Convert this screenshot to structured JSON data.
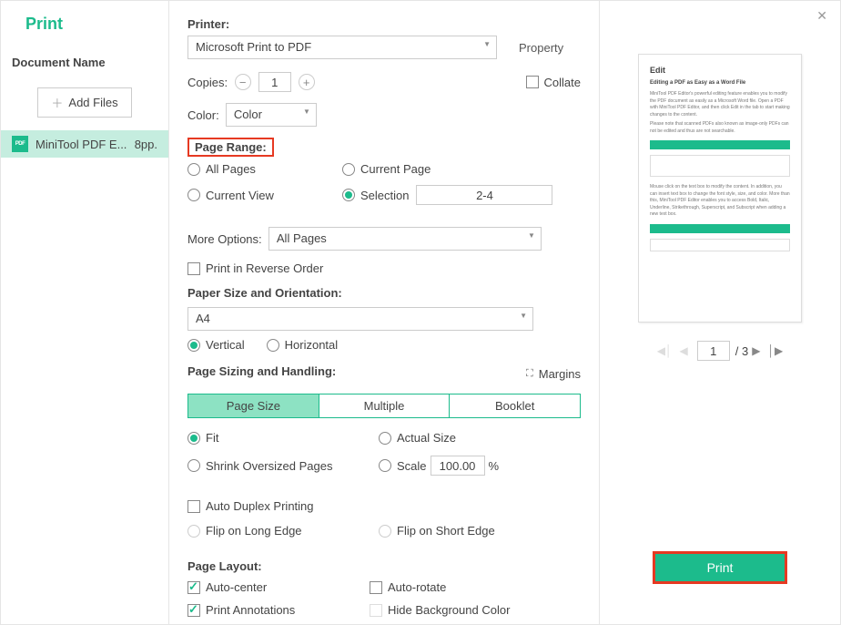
{
  "title": "Print",
  "docname_label": "Document Name",
  "addfiles": "Add Files",
  "file": {
    "name": "MiniTool PDF E...",
    "pages": "8pp."
  },
  "printer": {
    "label": "Printer:",
    "value": "Microsoft Print to PDF",
    "property": "Property"
  },
  "copies": {
    "label": "Copies:",
    "value": "1"
  },
  "collate": "Collate",
  "color": {
    "label": "Color:",
    "value": "Color"
  },
  "range": {
    "label": "Page Range:",
    "all": "All Pages",
    "current_page": "Current Page",
    "current_view": "Current View",
    "selection": "Selection",
    "selection_value": "2-4"
  },
  "more_options": {
    "label": "More Options:",
    "value": "All Pages"
  },
  "reverse": "Print in Reverse Order",
  "paper": {
    "label": "Paper Size and Orientation:",
    "size": "A4",
    "vertical": "Vertical",
    "horizontal": "Horizontal"
  },
  "sizing": {
    "label": "Page Sizing and Handling:",
    "margins": "Margins",
    "tabs": {
      "page_size": "Page Size",
      "multiple": "Multiple",
      "booklet": "Booklet"
    },
    "fit": "Fit",
    "actual": "Actual Size",
    "shrink": "Shrink Oversized Pages",
    "scale": "Scale",
    "scale_value": "100.00",
    "percent": "%"
  },
  "duplex": {
    "auto": "Auto Duplex Printing",
    "long": "Flip on Long Edge",
    "short": "Flip on Short Edge"
  },
  "layout": {
    "label": "Page Layout:",
    "autocenter": "Auto-center",
    "autorotate": "Auto-rotate",
    "annotations": "Print Annotations",
    "hidebg": "Hide Background Color"
  },
  "preview": {
    "h1": "Edit",
    "h2": "Editing a PDF as Easy as a Word File",
    "nav_page": "1",
    "nav_total": "/ 3"
  },
  "print_button": "Print"
}
